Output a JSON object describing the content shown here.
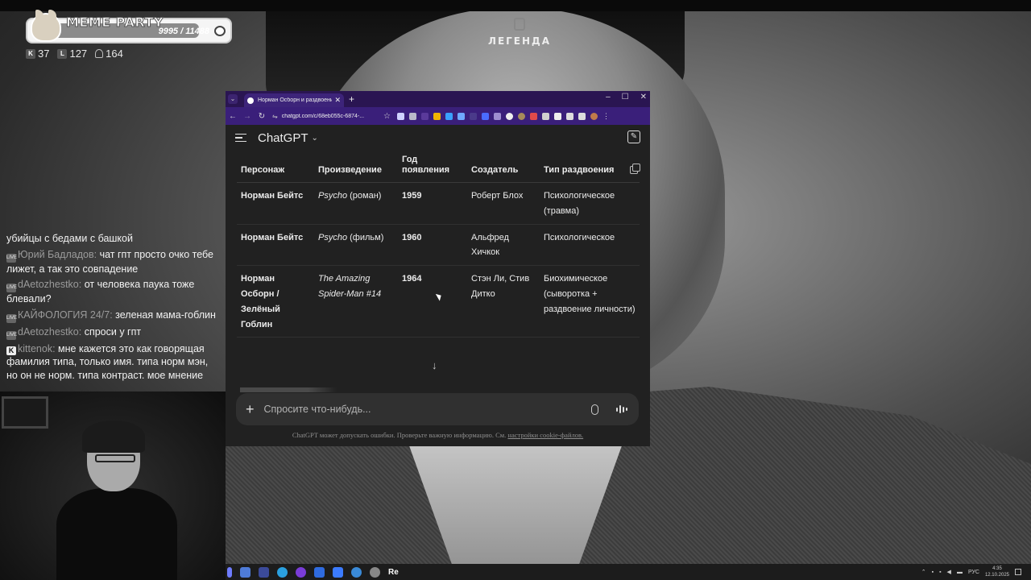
{
  "overlay": {
    "meme_bar": {
      "title": "MEME PARTY",
      "progress_text": "9995 / 11488",
      "progress_fraction": 0.87
    },
    "stats": [
      {
        "icon": "kick-icon",
        "value": "37"
      },
      {
        "icon": "vk-live-icon",
        "value": "127"
      },
      {
        "icon": "viewers-icon",
        "value": "164"
      }
    ],
    "legend_logo": "ЛЕГЕНДА"
  },
  "chat": [
    {
      "badge": "",
      "user": "",
      "text": "убийцы с бедами с башкой"
    },
    {
      "badge": "vk",
      "user": "Юрий Бадлaдов",
      "text": "чат гпт просто очко тебе лижет, а так это совпадение"
    },
    {
      "badge": "vk",
      "user": "dAetozhestko",
      "text": "от человека паука тоже блевали?"
    },
    {
      "badge": "vk",
      "user": "КАЙФОЛОГИЯ 24/7",
      "text": "зеленая мама-гоблин"
    },
    {
      "badge": "vk",
      "user": "dAetozhestko",
      "text": "спроси у гпт"
    },
    {
      "badge": "kick",
      "user": "kittenok",
      "text": "мне кажется это как говорящая фамилия типа, только имя. типа норм мэн, но он не норм. типа контраст. мое мнение"
    }
  ],
  "browser": {
    "tab_title": "Норман Осборн и раздвоение",
    "url": "chatgpt.com/c/68eb055c-6874-...",
    "app_title": "ChatGPT",
    "table": {
      "headers": [
        "Персонаж",
        "Произведение",
        "Год появления",
        "Создатель",
        "Тип раздвоения"
      ],
      "rows": [
        {
          "character": "Норман Бейтс",
          "work_title": "Psycho",
          "work_note": " (роман)",
          "year": "1959",
          "creator": "Роберт Блох",
          "type": "Психологическое (травма)"
        },
        {
          "character": "Норман Бейтс",
          "work_title": "Psycho",
          "work_note": " (фильм)",
          "year": "1960",
          "creator": "Альфред Хичкок",
          "type": "Психологическое"
        },
        {
          "character": "Норман Осборн / Зелёный Гоблин",
          "work_title": "The Amazing Spider-Man #14",
          "work_note": "",
          "year": "1964",
          "creator": "Стэн Ли, Стив Дитко",
          "type": "Биохимическое (сыворотка + раздвоение личности)"
        }
      ]
    },
    "composer_placeholder": "Спросите что-нибудь...",
    "disclaimer": "ChatGPT может допускать ошибки. Проверьте важную информацию. См.",
    "disclaimer_link": "настройки cookie-файлов."
  },
  "taskbar": {
    "app_label": "Re",
    "lang": "РУС",
    "time": "4:35",
    "date": "12.10.2025"
  },
  "colors": {
    "tab_strip": "#2a1552",
    "address_bar": "#3a1f7a",
    "chat_bg": "#212121",
    "composer_bg": "#303030"
  }
}
